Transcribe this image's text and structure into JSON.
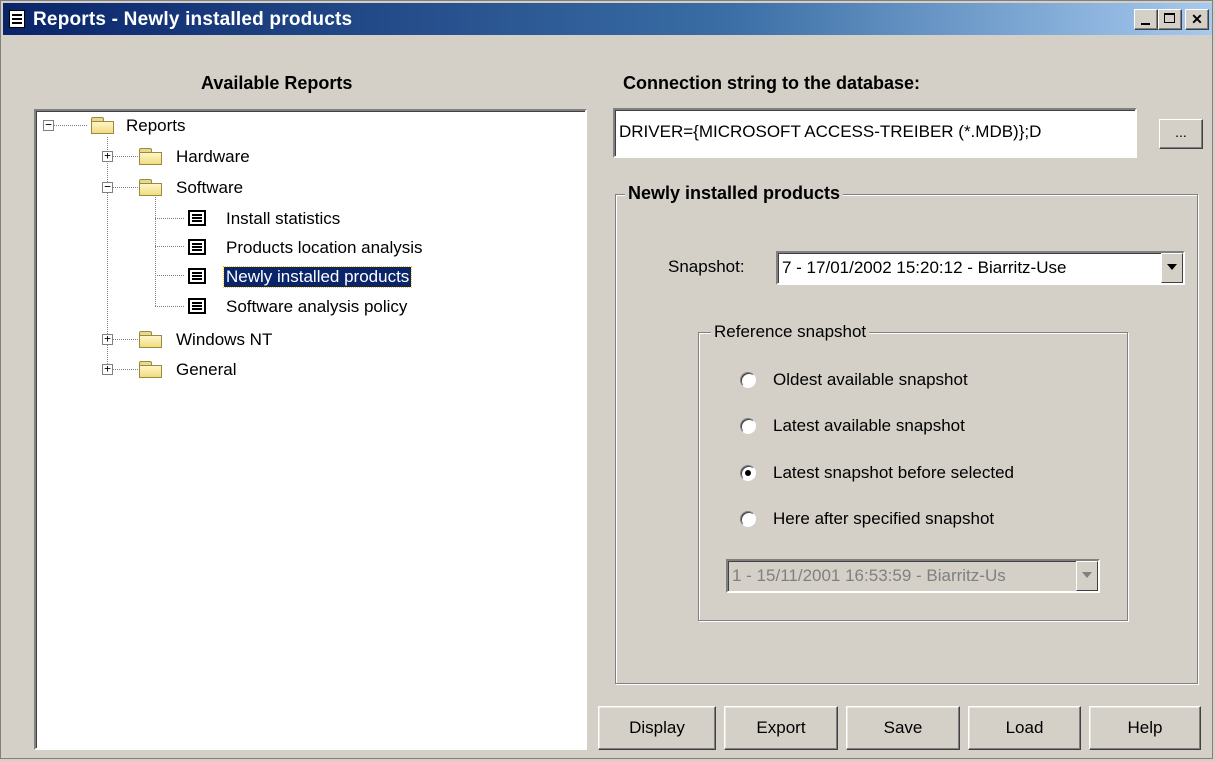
{
  "window": {
    "title": "Reports - Newly installed products"
  },
  "left": {
    "header": "Available Reports"
  },
  "tree": {
    "root": "Reports",
    "hardware": "Hardware",
    "software": "Software",
    "software_children": [
      "Install statistics",
      "Products location analysis",
      "Newly installed products",
      "Software analysis policy"
    ],
    "windows_nt": "Windows NT",
    "general": "General",
    "selected": "Newly installed products"
  },
  "connection": {
    "label": "Connection string to the database:",
    "value": "DRIVER={MICROSOFT ACCESS-TREIBER (*.MDB)};D",
    "browse_label": "..."
  },
  "group": {
    "title": "Newly installed products",
    "snapshot_label": "Snapshot:",
    "snapshot_value": "7 - 17/01/2002 15:20:12 - Biarritz-Use"
  },
  "reference": {
    "title": "Reference snapshot",
    "options": [
      "Oldest available snapshot",
      "Latest available snapshot",
      "Latest snapshot before selected",
      "Here after specified snapshot"
    ],
    "selected_index": 2,
    "specified_value": "1 - 15/11/2001 16:53:59 - Biarritz-Us"
  },
  "buttons": {
    "display": "Display",
    "export": "Export",
    "save": "Save",
    "load": "Load",
    "help": "Help"
  }
}
